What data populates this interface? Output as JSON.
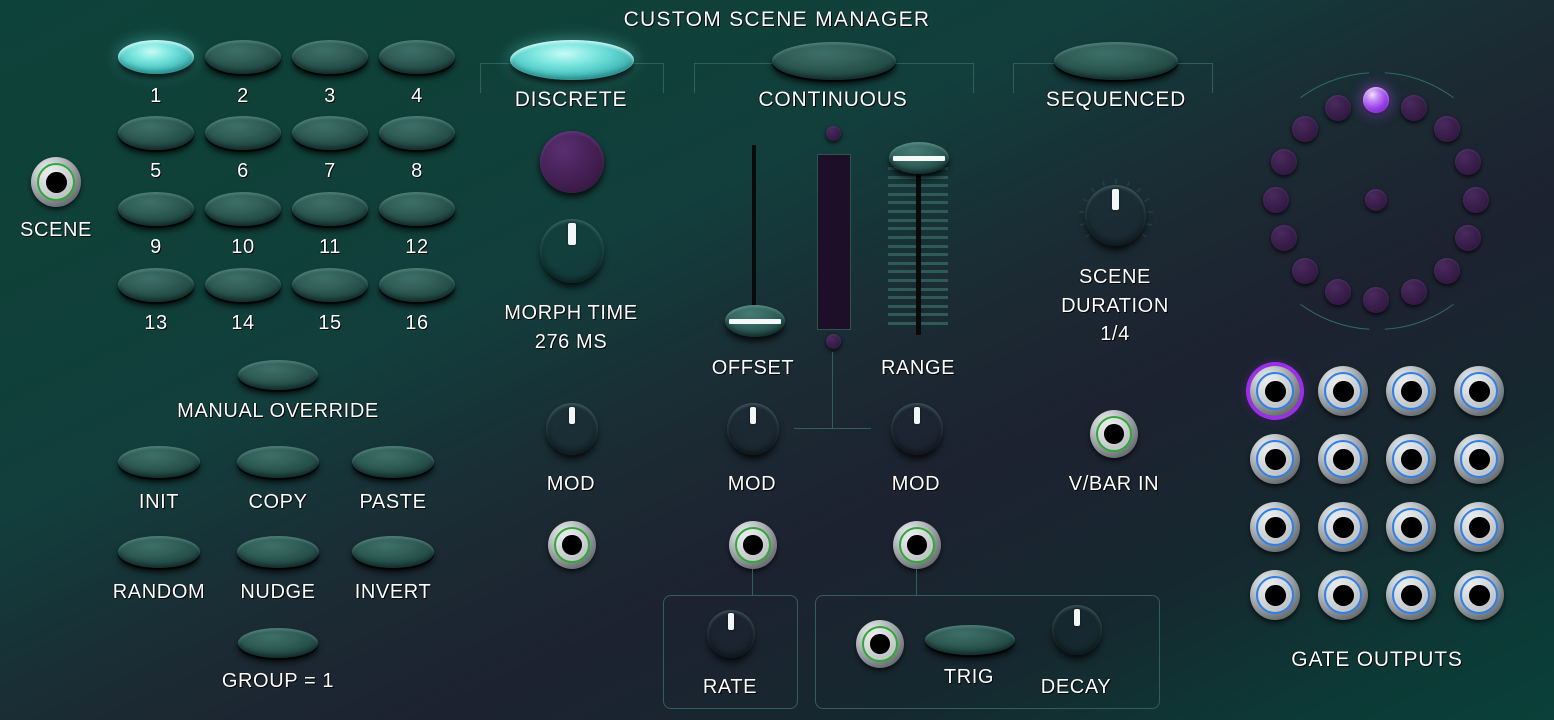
{
  "header": {
    "title": "CUSTOM SCENE MANAGER"
  },
  "scene_encoder": {
    "label": "SCENE",
    "jack_icon": "input-jack-icon"
  },
  "scene_buttons": {
    "labels": [
      "1",
      "2",
      "3",
      "4",
      "5",
      "6",
      "7",
      "8",
      "9",
      "10",
      "11",
      "12",
      "13",
      "14",
      "15",
      "16"
    ],
    "active_index": 0
  },
  "manual_override": {
    "label": "MANUAL OVERRIDE"
  },
  "edit_buttons": {
    "labels": [
      "INIT",
      "COPY",
      "PASTE",
      "RANDOM",
      "NUDGE",
      "INVERT"
    ]
  },
  "group_button": {
    "label": "GROUP = 1"
  },
  "modes": {
    "discrete": {
      "label": "DISCRETE",
      "active": true
    },
    "continuous": {
      "label": "CONTINUOUS",
      "active": false
    },
    "sequenced": {
      "label": "SEQUENCED",
      "active": false
    }
  },
  "discrete_section": {
    "led_name": "morph-indicator-led",
    "morph_knob": {
      "label": "MORPH TIME",
      "value": "276 MS",
      "angle_deg": 0
    },
    "mod_knob": {
      "label": "MOD",
      "angle_deg": 0
    },
    "mod_jack_name": "morph-mod-input-jack"
  },
  "continuous_section": {
    "offset": {
      "label": "OFFSET",
      "position_pct": 6
    },
    "range": {
      "label": "RANGE",
      "position_pct": 96
    },
    "bar_top_led": "continuous-top-led",
    "bar_bottom_led": "continuous-bottom-led",
    "offset_mod": {
      "label": "MOD",
      "angle_deg": 0
    },
    "range_mod": {
      "label": "MOD",
      "angle_deg": 0
    },
    "offset_mod_jack_name": "offset-mod-input-jack",
    "range_mod_jack_name": "range-mod-input-jack"
  },
  "sequenced_section": {
    "scene_duration": {
      "label_line1": "SCENE",
      "label_line2": "DURATION",
      "value": "1/4",
      "angle_deg": 0
    },
    "vbar_in": {
      "label": "V/BAR IN"
    }
  },
  "rate_panel": {
    "knob_label": "RATE",
    "angle_deg": 0
  },
  "trig_panel": {
    "jack_name": "trig-input-jack",
    "button_label": "TRIG",
    "decay_label": "DECAY",
    "decay_angle_deg": 0
  },
  "led_ring": {
    "count": 16,
    "active_index": 0,
    "center_led_name": "ring-center-led"
  },
  "gate_outputs": {
    "label": "GATE OUTPUTS",
    "count": 16,
    "selected_index": 0
  },
  "colors": {
    "panel_teal": "#0d4039",
    "panel_purple": "#2c2335",
    "button_lit": "#6ee6e0",
    "led_on": "#9b45e8",
    "jack_ring_green": "#2faa34",
    "jack_ring_blue": "#2f7fe8",
    "selection_purple": "#9b2fe8"
  }
}
